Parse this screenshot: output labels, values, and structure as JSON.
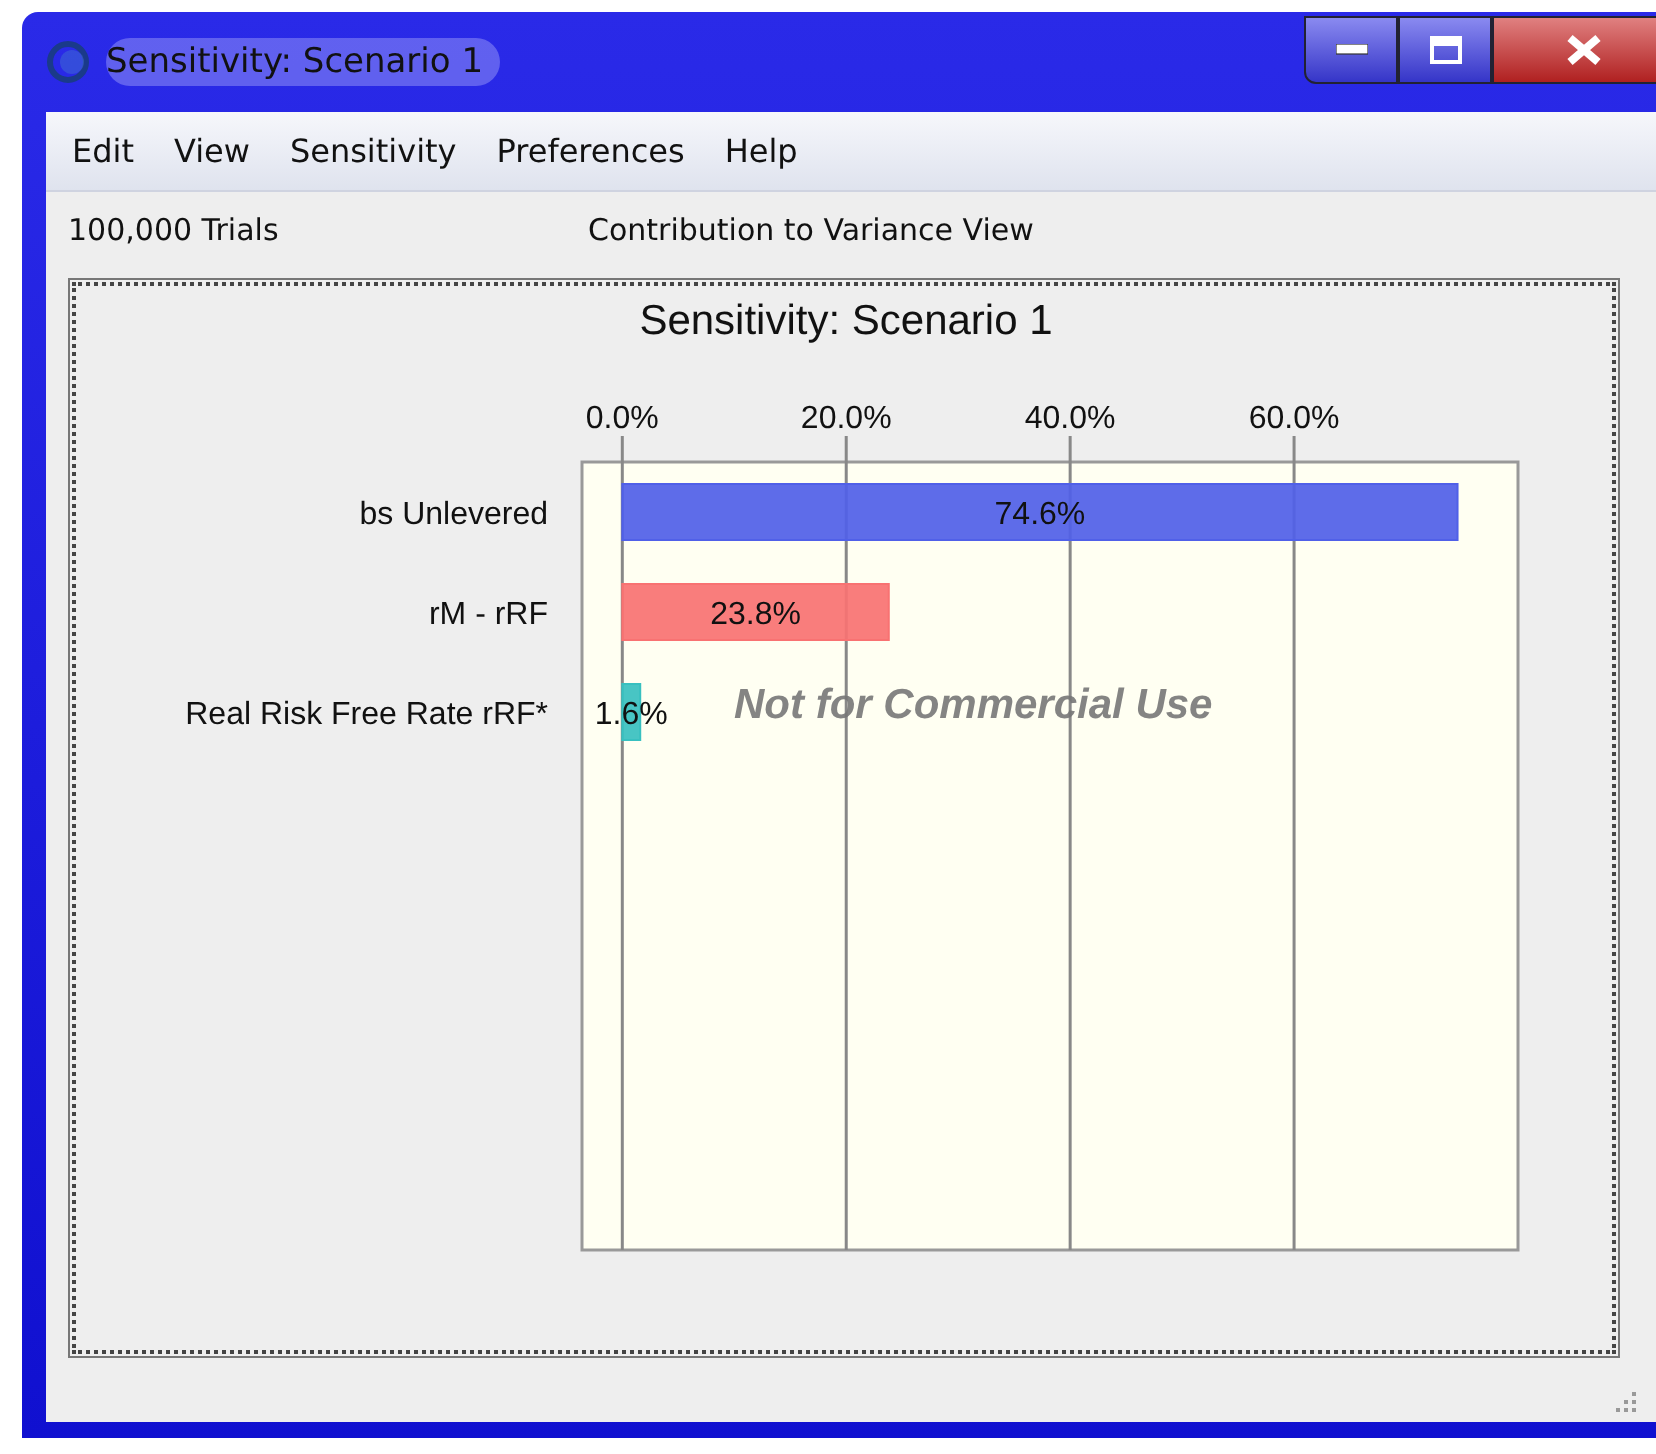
{
  "window": {
    "title": "Sensitivity: Scenario 1"
  },
  "menu": [
    "Edit",
    "View",
    "Sensitivity",
    "Preferences",
    "Help"
  ],
  "info": {
    "trials": "100,000 Trials",
    "view": "Contribution to Variance View"
  },
  "chart": {
    "watermark": "Not for Commercial Use",
    "chart_data": {
      "type": "bar",
      "orientation": "horizontal",
      "title": "Sensitivity: Scenario 1",
      "categories": [
        "bs Unlevered",
        "rM - rRF",
        "Real Risk Free Rate rRF*"
      ],
      "values": [
        74.6,
        23.8,
        1.6
      ],
      "colors": [
        "#5060e8",
        "#f87272",
        "#38c0c0"
      ],
      "value_labels": [
        "74.6%",
        "23.8%",
        "1.6%"
      ],
      "xlim": [
        -3.6,
        80
      ],
      "grid": true,
      "xticks": [
        {
          "value": 0,
          "label": "0.0%"
        },
        {
          "value": 20,
          "label": "20.0%"
        },
        {
          "value": 40,
          "label": "40.0%"
        },
        {
          "value": 60,
          "label": "60.0%"
        }
      ]
    }
  }
}
